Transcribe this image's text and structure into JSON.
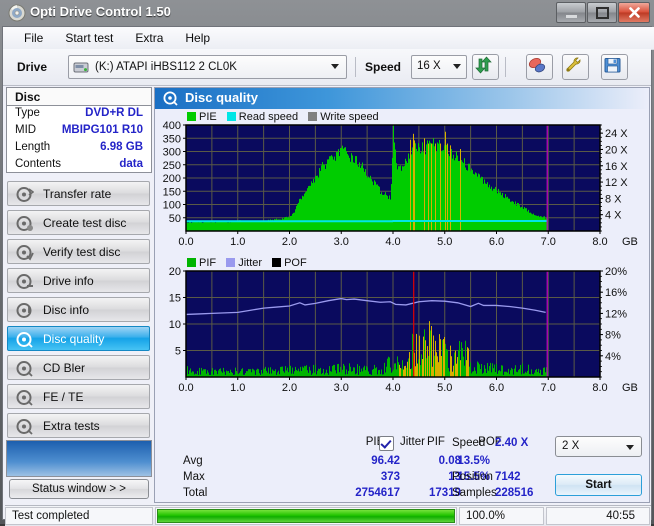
{
  "window": {
    "title": "Opti Drive Control 1.50",
    "icon": "disc-icon",
    "minimize_label": "_",
    "maximize_label": "□",
    "close_label": "✕"
  },
  "menu": {
    "items": [
      {
        "label": "File"
      },
      {
        "label": "Start test"
      },
      {
        "label": "Extra"
      },
      {
        "label": "Help"
      }
    ]
  },
  "toolbar": {
    "drive_label": "Drive",
    "drive_value": "(K:)  ATAPI iHBS112  2 CL0K",
    "drive_icon": "drive-icon",
    "speed_label": "Speed",
    "speed_value": "16 X",
    "refresh_icon": "refresh-icon",
    "eject_icon": "eject-icon",
    "tools_icon": "tools-icon",
    "save_icon": "save-icon"
  },
  "disc": {
    "header": "Disc",
    "rows": [
      {
        "key": "Type",
        "value": "DVD+R DL"
      },
      {
        "key": "MID",
        "value": "MBIPG101 R10"
      },
      {
        "key": "Length",
        "value": "6.98 GB"
      },
      {
        "key": "Contents",
        "value": "data"
      }
    ]
  },
  "sidebar": {
    "items": [
      {
        "label": "Transfer rate",
        "icon": "disc-speed-icon",
        "selected": false
      },
      {
        "label": "Create test disc",
        "icon": "disc-write-icon",
        "selected": false
      },
      {
        "label": "Verify test disc",
        "icon": "disc-verify-icon",
        "selected": false
      },
      {
        "label": "Drive info",
        "icon": "disc-info-icon",
        "selected": false
      },
      {
        "label": "Disc info",
        "icon": "disc-detail-icon",
        "selected": false
      },
      {
        "label": "Disc quality",
        "icon": "disc-quality-icon",
        "selected": true
      },
      {
        "label": "CD Bler",
        "icon": "disc-bler-icon",
        "selected": false
      },
      {
        "label": "FE / TE",
        "icon": "disc-fete-icon",
        "selected": false
      },
      {
        "label": "Extra tests",
        "icon": "disc-extra-icon",
        "selected": false
      }
    ],
    "status_window_button": "Status window > >"
  },
  "panel": {
    "title": "Disc quality",
    "title_icon": "disc-quality-icon"
  },
  "stats": {
    "col_headers": [
      "PIE",
      "PIF",
      "POF"
    ],
    "jitter_label": "Jitter",
    "jitter_checked": true,
    "row_labels": [
      "Avg",
      "Max",
      "Total"
    ],
    "pie": {
      "avg": "96.42",
      "max": "373",
      "total": "2754617"
    },
    "pif": {
      "avg": "0.08",
      "max": "13",
      "total": "17319"
    },
    "pof": {
      "avg": "",
      "max": "",
      "total": ""
    },
    "jitter": {
      "avg": "13.5%",
      "max": "15.5%",
      "total": ""
    },
    "speed_label": "Speed",
    "speed_value": "2.40 X",
    "position_label": "Position",
    "position_value": "7142",
    "samples_label": "Samples",
    "samples_value": "228516",
    "speed_select_value": "2 X",
    "start_button": "Start"
  },
  "statusbar": {
    "message": "Test completed",
    "percent": "100.0%",
    "elapsed": "40:55",
    "progress_value": 100
  },
  "colors": {
    "pie_green": "#00cc00",
    "read_speed_cyan": "#00e6e6",
    "write_speed_gray": "#808080",
    "pif_green": "#00b400",
    "jitter_lilac": "#9a9aee",
    "pof_black": "#000000",
    "chart_bg": "#0a0a5e",
    "gridline": "#5a5a46",
    "marker_magenta": "#c000c0",
    "marker_red": "#e00000",
    "spike_yellow": "#d8b000",
    "accent_blue": "#2424c8"
  },
  "chart_data": [
    {
      "type": "area",
      "name": "disc-quality-pie-chart",
      "title": "PIE / Read speed / Write speed",
      "legend": [
        {
          "label": "PIE",
          "color": "#00cc00"
        },
        {
          "label": "Read speed",
          "color": "#00e6e6"
        },
        {
          "label": "Write speed",
          "color": "#808080"
        }
      ],
      "legend_position": "top-left",
      "xlabel": "GB",
      "x_ticks": [
        "0.0",
        "1.0",
        "2.0",
        "3.0",
        "4.0",
        "5.0",
        "6.0",
        "7.0",
        "8.0"
      ],
      "xlim": [
        0,
        8
      ],
      "ylabel_left": "PIE",
      "y_ticks_left": [
        "50",
        "100",
        "150",
        "200",
        "250",
        "300",
        "350",
        "400"
      ],
      "ylim_left": [
        0,
        400
      ],
      "ylabel_right": "Speed",
      "y_ticks_right": [
        "4 X",
        "8 X",
        "12 X",
        "16 X",
        "20 X",
        "24 X"
      ],
      "ylim_right": [
        0,
        26
      ],
      "grid": true,
      "data_end_gb": 6.98,
      "markers": [
        {
          "x": 6.98,
          "color": "#c000c0"
        }
      ],
      "series": [
        {
          "name": "PIE",
          "color": "#00cc00",
          "x": [
            0.0,
            0.1,
            0.2,
            0.3,
            0.4,
            0.5,
            0.6,
            0.7,
            0.8,
            0.9,
            1.0,
            1.1,
            1.2,
            1.3,
            1.4,
            1.5,
            1.6,
            1.7,
            1.8,
            1.9,
            2.0,
            2.1,
            2.2,
            2.3,
            2.4,
            2.5,
            2.6,
            2.7,
            2.8,
            2.9,
            3.0,
            3.1,
            3.2,
            3.3,
            3.4,
            3.5,
            3.6,
            3.7,
            3.8,
            3.9,
            3.95,
            4.0,
            4.05,
            4.1,
            4.2,
            4.3,
            4.4,
            4.5,
            4.6,
            4.7,
            4.8,
            4.9,
            5.0,
            5.1,
            5.2,
            5.3,
            5.4,
            5.5,
            5.6,
            5.7,
            5.8,
            5.9,
            6.0,
            6.1,
            6.2,
            6.3,
            6.4,
            6.5,
            6.6,
            6.7,
            6.8,
            6.9,
            6.98
          ],
          "values": [
            34,
            32,
            35,
            33,
            36,
            34,
            33,
            35,
            34,
            36,
            38,
            36,
            35,
            37,
            36,
            38,
            40,
            42,
            45,
            48,
            52,
            78,
            120,
            150,
            175,
            200,
            235,
            255,
            270,
            285,
            298,
            290,
            275,
            260,
            240,
            215,
            185,
            160,
            140,
            130,
            125,
            373,
            260,
            230,
            245,
            275,
            300,
            318,
            305,
            330,
            322,
            318,
            305,
            300,
            280,
            265,
            250,
            230,
            210,
            195,
            180,
            165,
            150,
            138,
            125,
            112,
            100,
            88,
            76,
            66,
            58,
            52,
            48
          ]
        },
        {
          "name": "Read speed",
          "color": "#00e6e6",
          "x": [
            0.0,
            1.0,
            2.0,
            3.0,
            3.99,
            4.0,
            5.0,
            6.0,
            6.98
          ],
          "values": [
            2.4,
            2.4,
            2.4,
            2.4,
            2.4,
            2.45,
            2.45,
            2.45,
            2.45
          ]
        }
      ]
    },
    {
      "type": "area",
      "name": "disc-quality-pif-chart",
      "title": "PIF / Jitter / POF",
      "legend": [
        {
          "label": "PIF",
          "color": "#00b400"
        },
        {
          "label": "Jitter",
          "color": "#9a9aee"
        },
        {
          "label": "POF",
          "color": "#000000"
        }
      ],
      "legend_position": "top-left",
      "xlabel": "GB",
      "x_ticks": [
        "0.0",
        "1.0",
        "2.0",
        "3.0",
        "4.0",
        "5.0",
        "6.0",
        "7.0",
        "8.0"
      ],
      "xlim": [
        0,
        8
      ],
      "ylabel_left": "PIF",
      "y_ticks_left": [
        "5",
        "10",
        "15",
        "20"
      ],
      "ylim_left": [
        0,
        20
      ],
      "ylabel_right": "Jitter",
      "y_ticks_right": [
        "4%",
        "8%",
        "12%",
        "16%",
        "20%"
      ],
      "ylim_right": [
        0,
        20
      ],
      "grid": true,
      "data_end_gb": 6.98,
      "markers": [
        {
          "x": 4.4,
          "color": "#e00000"
        },
        {
          "x": 6.98,
          "color": "#c000c0"
        }
      ],
      "series": [
        {
          "name": "Jitter",
          "color": "#9a9aee",
          "x": [
            0.0,
            0.25,
            0.5,
            0.75,
            1.0,
            1.25,
            1.5,
            1.75,
            2.0,
            2.2,
            2.3,
            2.5,
            2.75,
            3.0,
            3.1,
            3.25,
            3.5,
            3.75,
            3.95,
            4.05,
            4.25,
            4.5,
            4.75,
            5.0,
            5.25,
            5.5,
            5.65,
            5.75,
            6.0,
            6.25,
            6.5,
            6.75,
            6.95
          ],
          "values": [
            11.8,
            11.9,
            12.0,
            12.1,
            12.2,
            12.6,
            13.0,
            13.2,
            13.4,
            14.0,
            13.6,
            13.9,
            14.4,
            14.8,
            14.6,
            14.7,
            14.4,
            14.1,
            14.2,
            13.7,
            13.6,
            14.2,
            14.4,
            14.3,
            14.0,
            13.3,
            13.9,
            13.5,
            13.5,
            13.3,
            13.0,
            12.6,
            12.2
          ]
        },
        {
          "name": "PIF",
          "color": "#00b400",
          "x": [
            0.0,
            0.2,
            0.4,
            0.6,
            0.8,
            1.0,
            1.2,
            1.4,
            1.6,
            1.8,
            2.0,
            2.2,
            2.4,
            2.6,
            2.8,
            3.0,
            3.2,
            3.4,
            3.6,
            3.8,
            4.0,
            4.1,
            4.2,
            4.3,
            4.4,
            4.5,
            4.6,
            4.7,
            4.8,
            4.9,
            5.0,
            5.1,
            5.2,
            5.3,
            5.4,
            5.5,
            5.7,
            5.9,
            6.1,
            6.3,
            6.5,
            6.7,
            6.9
          ],
          "values": [
            1.2,
            1.0,
            1.1,
            0.9,
            1.2,
            1.0,
            1.1,
            1.0,
            1.2,
            1.1,
            1.3,
            1.1,
            1.4,
            1.3,
            1.5,
            1.6,
            1.5,
            1.4,
            1.3,
            1.5,
            3.0,
            2.0,
            2.6,
            3.4,
            5.8,
            4.6,
            5.2,
            6.5,
            5.9,
            5.0,
            4.4,
            3.8,
            3.2,
            4.8,
            4.0,
            2.2,
            1.9,
            1.6,
            1.4,
            1.3,
            1.5,
            1.2,
            1.1
          ]
        }
      ]
    }
  ]
}
